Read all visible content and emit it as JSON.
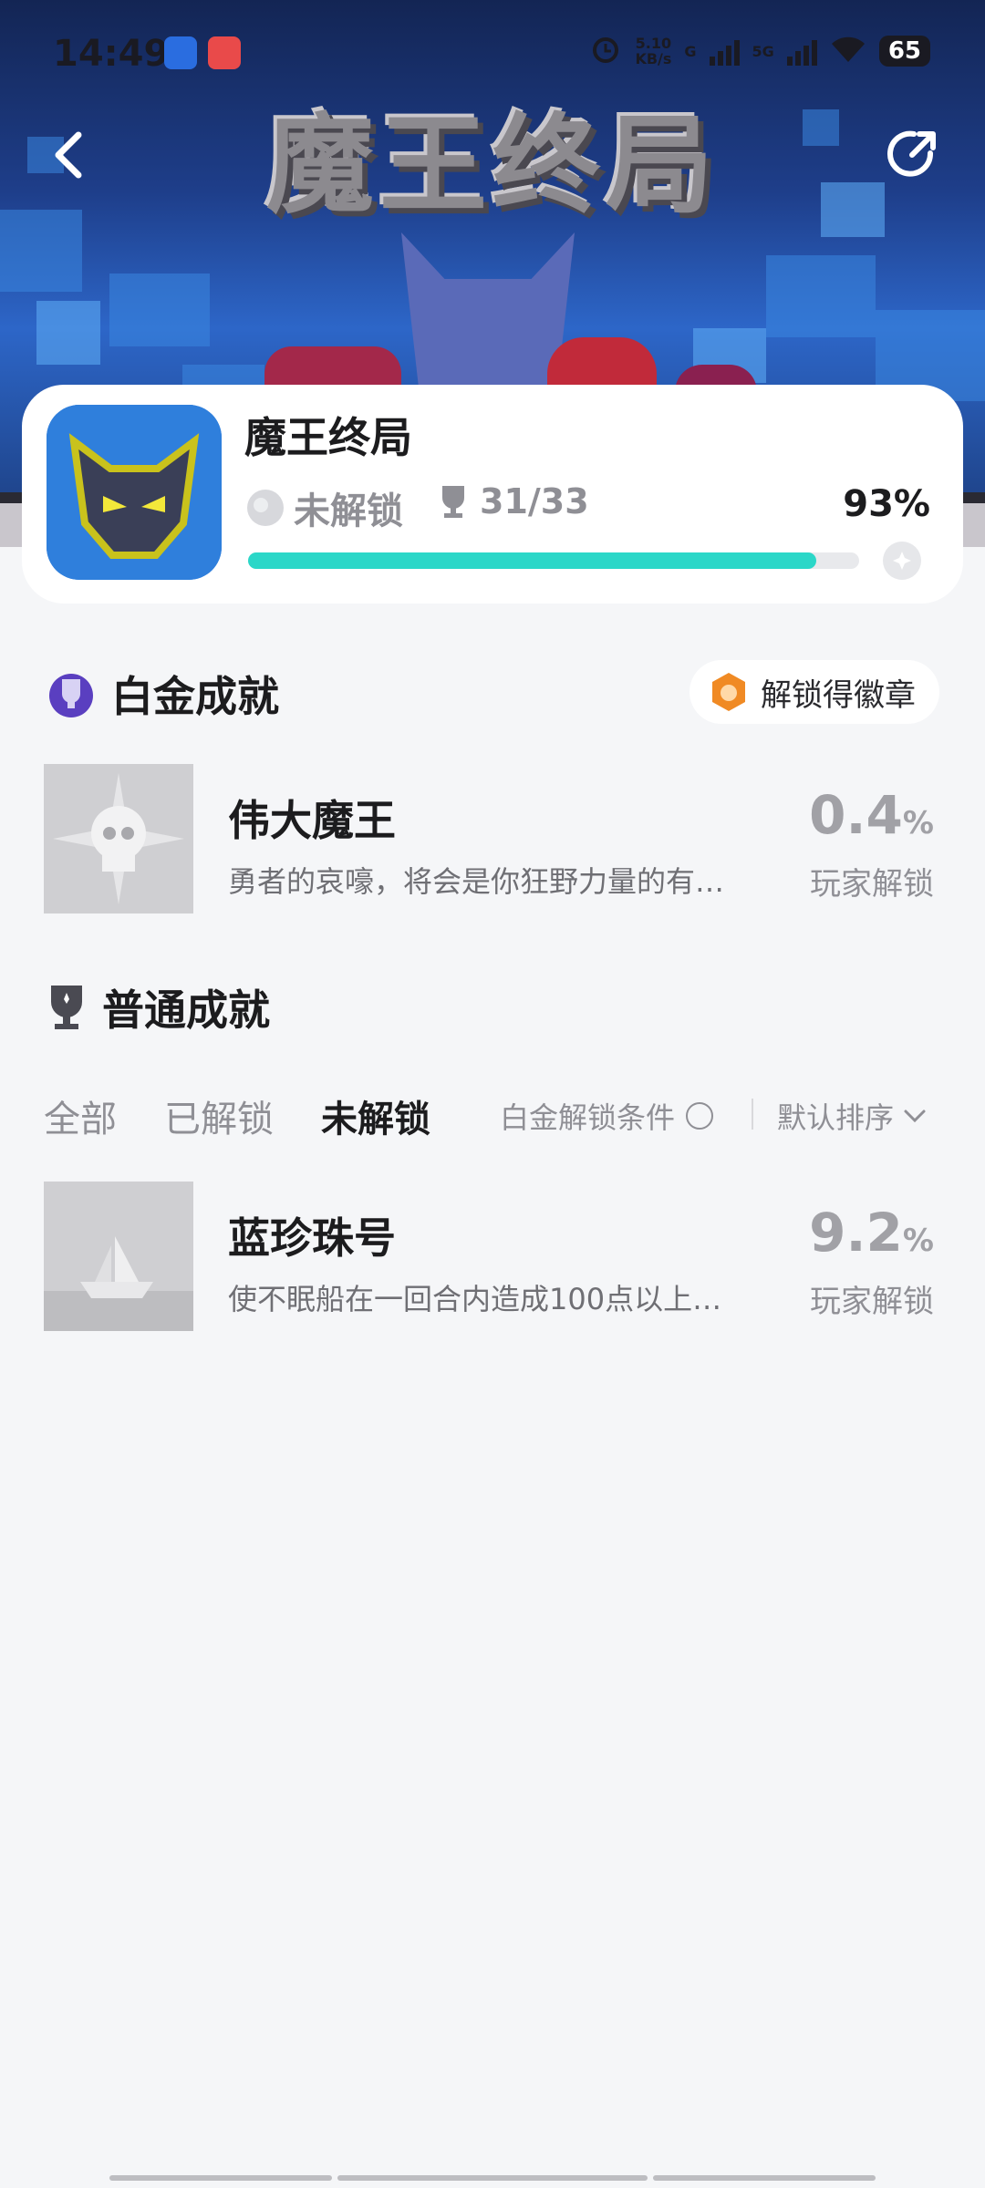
{
  "status_bar": {
    "time": "14:49",
    "network_speed": "5.10",
    "network_unit": "KB/s",
    "sig1": "G",
    "sig2": "5G",
    "battery": "65"
  },
  "banner": {
    "title": "魔王终局"
  },
  "game": {
    "name": "魔王终局",
    "unlock_status": "未解锁",
    "trophies": "31/33",
    "progress_percent": "93%",
    "progress_value": 0.93
  },
  "platinum": {
    "section_title": "白金成就",
    "badge_button": "解锁得徽章",
    "items": [
      {
        "name": "伟大魔王",
        "description": "勇者的哀嚎，将会是你狂野力量的有…",
        "percent": "0.4",
        "percent_unit": "%",
        "sub": "玩家解锁"
      }
    ]
  },
  "normal": {
    "section_title": "普通成就",
    "tabs": [
      "全部",
      "已解锁",
      "未解锁"
    ],
    "active_tab": 2,
    "filter_label": "白金解锁条件",
    "sort_label": "默认排序",
    "items": [
      {
        "name": "蓝珍珠号",
        "description": "使不眠船在一回合内造成100点以上…",
        "percent": "9.2",
        "percent_unit": "%",
        "sub": "玩家解锁"
      }
    ]
  },
  "colors": {
    "accent": "#2bd7c8",
    "banner_blue": "#2d66c8",
    "badge_orange": "#f08a24"
  },
  "icons": [
    "back-arrow-icon",
    "share-icon",
    "platinum-trophy-icon",
    "trophy-icon",
    "unlock-medal-icon",
    "badge-medal-icon",
    "chevron-down-icon"
  ]
}
